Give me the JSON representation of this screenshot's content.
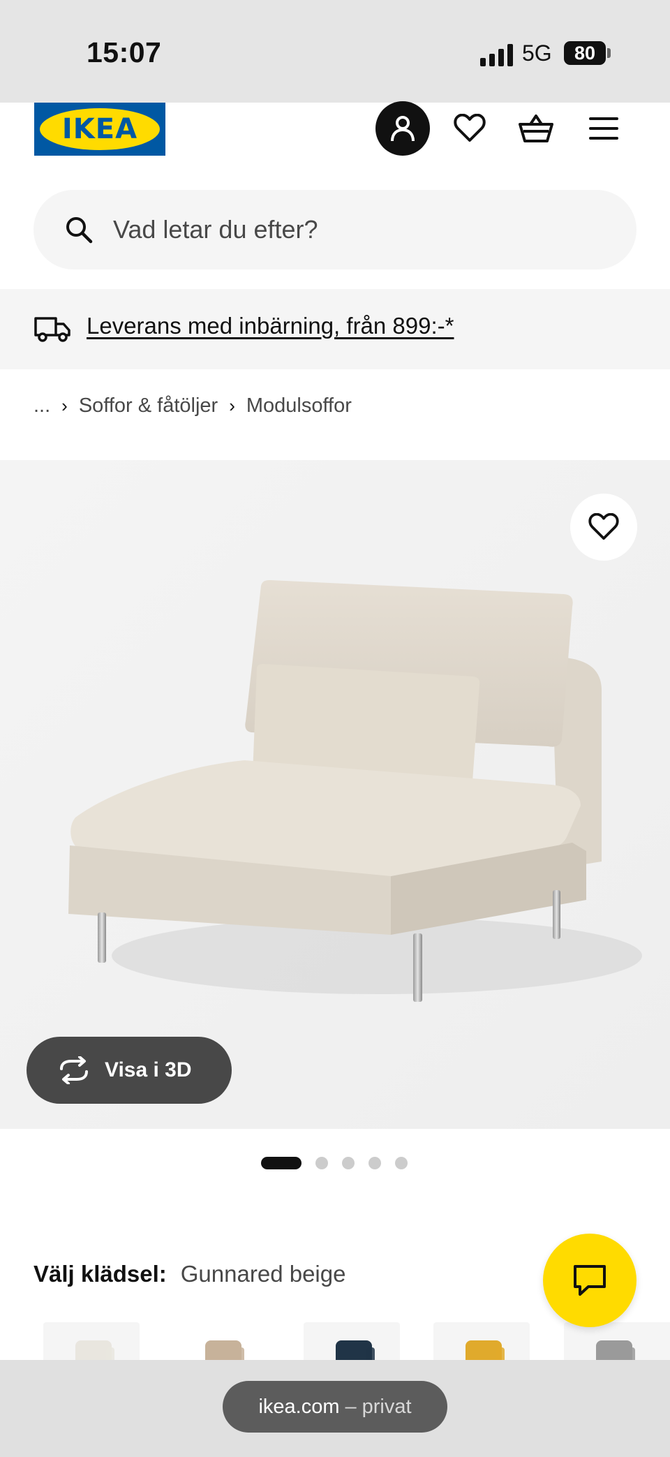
{
  "status_bar": {
    "time": "15:07",
    "network": "5G",
    "battery": "80"
  },
  "header": {
    "logo_text": "IKEA"
  },
  "search": {
    "placeholder": "Vad letar du efter?"
  },
  "delivery": {
    "text": "Leverans med inbärning, från 899:-*"
  },
  "breadcrumb": {
    "ellipsis": "...",
    "items": [
      "Soffor & fåtöljer",
      "Modulsoffor"
    ],
    "separator": "›"
  },
  "product_image": {
    "view_3d_label": "Visa i 3D",
    "carousel": {
      "total": 5,
      "active": 1
    }
  },
  "upholstery": {
    "label": "Välj klädsel:",
    "selected": "Gunnared beige",
    "swatches": [
      {
        "color": "#e9e6df"
      },
      {
        "color": "#c7b29a"
      },
      {
        "color": "#203447"
      },
      {
        "color": "#e0aa2c"
      },
      {
        "color": "#9a9a9a"
      }
    ]
  },
  "browser": {
    "domain": "ikea.com",
    "separator": "–",
    "mode": "privat"
  },
  "colors": {
    "brand_blue": "#0058a3",
    "brand_yellow": "#ffdb00",
    "dark": "#111111"
  }
}
